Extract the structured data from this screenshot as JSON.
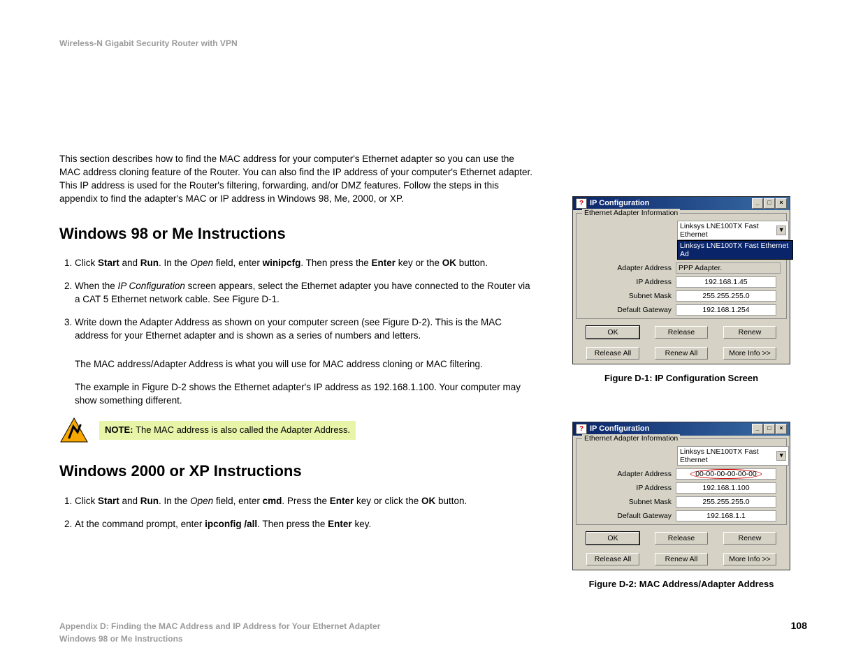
{
  "header": "Wireless-N Gigabit Security Router with VPN",
  "intro": "This section describes how to find the MAC address for your computer's Ethernet adapter so you can use the MAC address cloning feature of the Router. You can also find the IP address of your computer's Ethernet adapter. This IP address is used for the Router's filtering, forwarding, and/or DMZ features. Follow the steps in this appendix to find the adapter's MAC or IP address in Windows 98, Me, 2000, or XP.",
  "h_win98": "Windows 98 or Me Instructions",
  "win98_step1_a": "Click ",
  "win98_step1_b": "Start",
  "win98_step1_c": " and ",
  "win98_step1_d": "Run",
  "win98_step1_e": ". In the ",
  "win98_step1_f": "Open",
  "win98_step1_g": " field, enter ",
  "win98_step1_h": "winipcfg",
  "win98_step1_i": ". Then press the ",
  "win98_step1_j": "Enter",
  "win98_step1_k": " key or the ",
  "win98_step1_l": "OK",
  "win98_step1_m": " button.",
  "win98_step2_a": "When the ",
  "win98_step2_b": "IP Configuration",
  "win98_step2_c": " screen appears, select the Ethernet adapter you have connected to the Router via a CAT 5 Ethernet network cable. See Figure D-1.",
  "win98_step3": "Write down the Adapter Address as shown on your computer screen (see Figure D-2). This is the MAC address for your Ethernet adapter and is shown as a series of numbers and letters.",
  "indent1": "The MAC address/Adapter Address is what you will use for MAC address cloning or MAC filtering.",
  "indent2": "The example in Figure D-2 shows the Ethernet adapter's IP address as 192.168.1.100. Your computer may show something different.",
  "note_label": "NOTE: ",
  "note_text": "The MAC address is also called the Adapter Address.",
  "h_win2k": "Windows 2000 or XP Instructions",
  "win2k_step1_a": "Click ",
  "win2k_step1_b": "Start",
  "win2k_step1_c": " and ",
  "win2k_step1_d": "Run",
  "win2k_step1_e": ". In the ",
  "win2k_step1_f": "Open",
  "win2k_step1_g": " field, enter ",
  "win2k_step1_h": "cmd",
  "win2k_step1_i": ". Press the ",
  "win2k_step1_j": "Enter",
  "win2k_step1_k": " key or click the ",
  "win2k_step1_l": "OK",
  "win2k_step1_m": " button.",
  "win2k_step2_a": "At the command prompt, enter ",
  "win2k_step2_b": "ipconfig /all",
  "win2k_step2_c": ". Then press the ",
  "win2k_step2_d": "Enter",
  "win2k_step2_e": " key.",
  "fig1_caption": "Figure D-1: IP Configuration Screen",
  "fig2_caption": "Figure D-2: MAC Address/Adapter Address",
  "ipwin": {
    "title": "IP Configuration",
    "fieldset": "Ethernet Adapter Information",
    "adapter_sel": "Linksys LNE100TX Fast Ethernet",
    "adapter_expanded": "Linksys LNE100TX Fast Ethernet Ad",
    "ppp": "PPP Adapter.",
    "lbl_adapter": "Adapter Address",
    "lbl_ip": "IP Address",
    "lbl_subnet": "Subnet Mask",
    "lbl_gw": "Default Gateway",
    "f1": {
      "ip": "192.168.1.45",
      "subnet": "255.255.255.0",
      "gw": "192.168.1.254"
    },
    "f2": {
      "mac": "00-00-00-00-00-00",
      "ip": "192.168.1.100",
      "subnet": "255.255.255.0",
      "gw": "192.168.1.1"
    },
    "btn_ok": "OK",
    "btn_release": "Release",
    "btn_renew": "Renew",
    "btn_release_all": "Release All",
    "btn_renew_all": "Renew All",
    "btn_more": "More Info >>"
  },
  "footer1": "Appendix D: Finding the MAC Address and IP Address for Your Ethernet Adapter",
  "footer2": "Windows 98 or Me Instructions",
  "page_num": "108"
}
